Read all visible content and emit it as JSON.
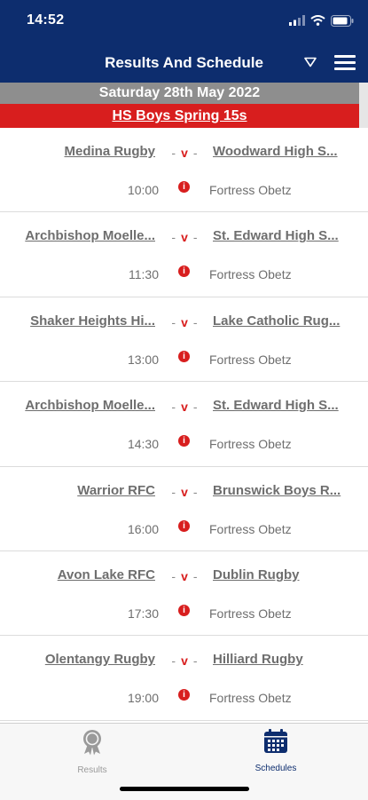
{
  "status_bar": {
    "time": "14:52",
    "icons": [
      "signal-icon",
      "wifi-icon",
      "battery-icon"
    ]
  },
  "header": {
    "title": "Results And Schedule",
    "filter_icon": "filter-icon",
    "menu_icon": "hamburger-menu-icon"
  },
  "date_label": "Saturday 28th May 2022",
  "competition": "HS Boys Spring 15s",
  "matches": [
    {
      "home": "Medina Rugby",
      "away": "Woodward High S...",
      "time": "10:00",
      "venue": "Fortress Obetz"
    },
    {
      "home": "Archbishop Moelle...",
      "away": "St. Edward High S...",
      "time": "11:30",
      "venue": "Fortress Obetz"
    },
    {
      "home": "Shaker Heights Hi...",
      "away": "Lake Catholic Rug...",
      "time": "13:00",
      "venue": "Fortress Obetz"
    },
    {
      "home": "Archbishop Moelle...",
      "away": "St. Edward High S...",
      "time": "14:30",
      "venue": "Fortress Obetz"
    },
    {
      "home": "Warrior RFC",
      "away": "Brunswick Boys R...",
      "time": "16:00",
      "venue": "Fortress Obetz"
    },
    {
      "home": "Avon Lake RFC",
      "away": "Dublin Rugby",
      "time": "17:30",
      "venue": "Fortress Obetz"
    },
    {
      "home": "Olentangy Rugby",
      "away": "Hilliard Rugby",
      "time": "19:00",
      "venue": "Fortress Obetz"
    }
  ],
  "vs": {
    "dash": "-",
    "v": "v"
  },
  "info_glyph": "i",
  "tabs": [
    {
      "label": "Results",
      "icon": "award-ribbon-icon",
      "active": false
    },
    {
      "label": "Schedules",
      "icon": "calendar-icon",
      "active": true
    }
  ],
  "colors": {
    "header_navy": "#0d2d6e",
    "date_gray": "#8e8e8e",
    "accent_red": "#d81e1e",
    "text_gray": "#6e6e6e"
  }
}
